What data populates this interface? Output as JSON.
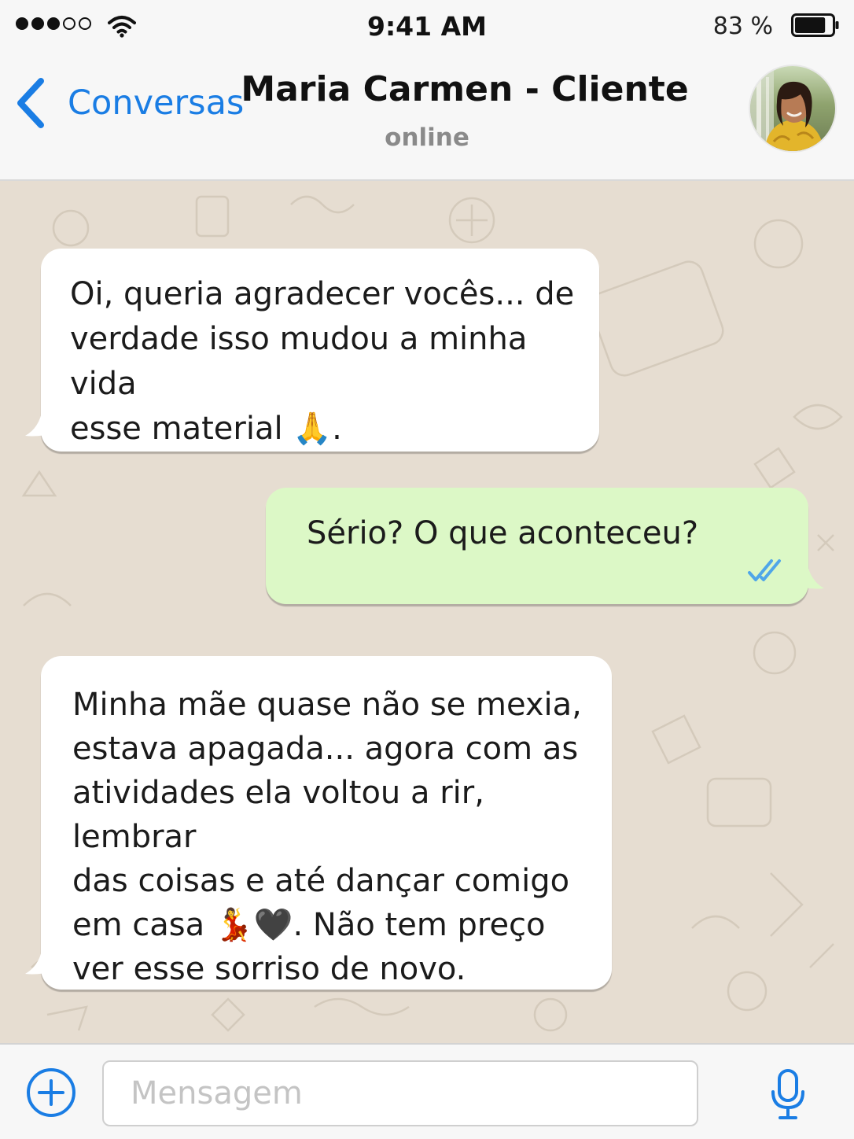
{
  "status_bar": {
    "time": "9:41 AM",
    "battery_percent": "83 %",
    "signal_bars_full": 3,
    "signal_bars_total": 5,
    "battery_level": 0.83
  },
  "nav": {
    "back_label": "Conversas",
    "contact_name": "Maria Carmen - Cliente",
    "contact_status": "online"
  },
  "messages": [
    {
      "direction": "incoming",
      "text": "Oi, queria agradecer vocês... de\nverdade isso mudou a minha vida\nesse material 🙏."
    },
    {
      "direction": "outgoing",
      "text": "Sério? O que aconteceu?",
      "status": "read"
    },
    {
      "direction": "incoming",
      "text": "Minha mãe quase não se mexia,\nestava apagada... agora com as\natividades ela voltou a rir, lembrar\ndas coisas e até dançar comigo\nem casa 💃🖤. Não tem preço\nver esse sorriso de novo."
    }
  ],
  "composer": {
    "placeholder": "Mensagem",
    "value": ""
  },
  "icons": {
    "back": "chevron-left-icon",
    "attach": "plus-circle-icon",
    "mic": "microphone-icon",
    "read_receipt": "double-check-icon",
    "wifi": "wifi-icon",
    "battery": "battery-icon"
  },
  "colors": {
    "accent": "#1a7de4",
    "incoming_bubble": "#ffffff",
    "outgoing_bubble": "#dcf8c6",
    "chat_background": "#e6ddd1",
    "read_tick": "#4fa6e8"
  }
}
